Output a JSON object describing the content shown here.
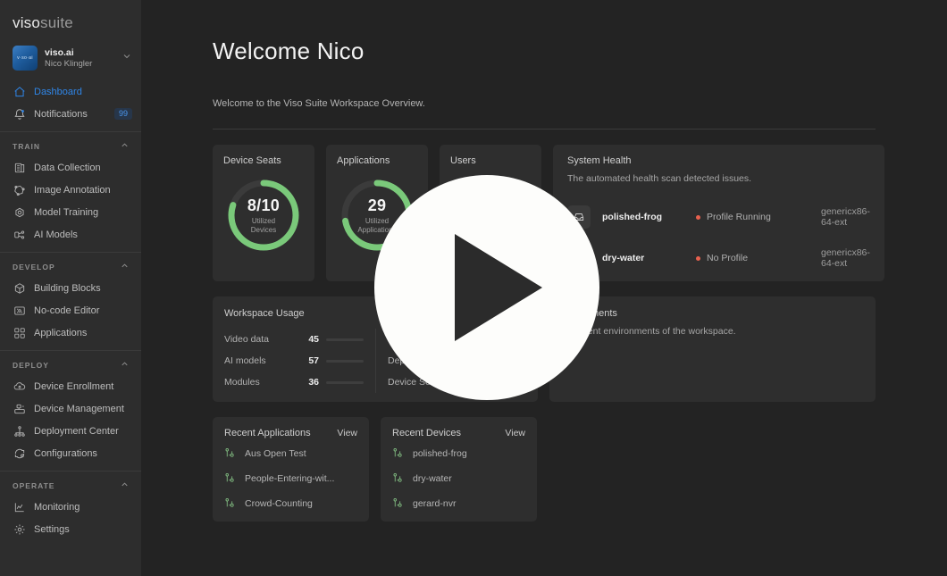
{
  "sidebar": {
    "logo": {
      "bold": "viso",
      "light": "suite"
    },
    "account": {
      "avatar_text": "v·so·ai",
      "name": "viso.ai",
      "user": "Nico Klingler",
      "chevron": "chevron-down-icon"
    },
    "top_items": [
      {
        "label": "Dashboard",
        "icon": "home-icon",
        "active": true
      },
      {
        "label": "Notifications",
        "icon": "bell-icon",
        "badge": "99",
        "active": false
      }
    ],
    "sections": [
      {
        "title": "TRAIN",
        "items": [
          {
            "label": "Data Collection",
            "icon": "database-icon"
          },
          {
            "label": "Image Annotation",
            "icon": "annotation-icon"
          },
          {
            "label": "Model Training",
            "icon": "training-icon"
          },
          {
            "label": "AI Models",
            "icon": "models-icon"
          }
        ]
      },
      {
        "title": "DEVELOP",
        "items": [
          {
            "label": "Building Blocks",
            "icon": "cube-icon"
          },
          {
            "label": "No-code Editor",
            "icon": "editor-icon"
          },
          {
            "label": "Applications",
            "icon": "applications-icon"
          }
        ]
      },
      {
        "title": "DEPLOY",
        "items": [
          {
            "label": "Device Enrollment",
            "icon": "cloud-upload-icon"
          },
          {
            "label": "Device Management",
            "icon": "device-manage-icon"
          },
          {
            "label": "Deployment Center",
            "icon": "hierarchy-icon"
          },
          {
            "label": "Configurations",
            "icon": "config-gear-icon"
          }
        ]
      },
      {
        "title": "OPERATE",
        "items": [
          {
            "label": "Monitoring",
            "icon": "chart-icon"
          },
          {
            "label": "Settings",
            "icon": "gear-icon"
          }
        ]
      }
    ]
  },
  "header": {
    "title": "Welcome Nico",
    "subtitle": "Welcome to the Viso Suite Workspace Overview."
  },
  "stats": [
    {
      "title": "Device Seats",
      "value": "8/10",
      "caption_line1": "Utilized",
      "caption_line2": "Devices",
      "percent": 80
    },
    {
      "title": "Applications",
      "value": "29",
      "caption_line1": "Utilized",
      "caption_line2": "Applications",
      "percent": 72
    },
    {
      "title": "Users",
      "value": "",
      "caption_line1": "",
      "caption_line2": "",
      "percent": 0
    }
  ],
  "system_health": {
    "title": "System Health",
    "subtitle": "The automated health scan detected issues.",
    "rows": [
      {
        "icon": "inbox-icon",
        "name": "polished-frog",
        "status": "Profile Running",
        "status_color": "#e8614e",
        "arch": "genericx86-64-ext"
      },
      {
        "icon": "inbox-icon",
        "name": "dry-water",
        "status": "No Profile",
        "status_color": "#e8614e",
        "arch": "genericx86-64-ext"
      }
    ]
  },
  "workspace_usage": {
    "title": "Workspace Usage",
    "left": [
      {
        "label": "Video data",
        "value": "45"
      },
      {
        "label": "AI models",
        "value": "57"
      },
      {
        "label": "Modules",
        "value": "36"
      }
    ],
    "right": [
      {
        "label": "",
        "value": ""
      },
      {
        "label": "Dep",
        "value": ""
      },
      {
        "label": "Device Sea",
        "value": ""
      }
    ]
  },
  "environments": {
    "title": "nvironments",
    "subtitle": "e current environments of the workspace."
  },
  "recent_applications": {
    "title": "Recent Applications",
    "view_label": "View",
    "items": [
      {
        "icon": "node-icon",
        "label": "Aus Open Test"
      },
      {
        "icon": "node-icon",
        "label": "People-Entering-wit..."
      },
      {
        "icon": "node-icon",
        "label": "Crowd-Counting"
      }
    ]
  },
  "recent_devices": {
    "title": "Recent Devices",
    "view_label": "View",
    "items": [
      {
        "icon": "node-icon",
        "label": "polished-frog"
      },
      {
        "icon": "node-icon",
        "label": "dry-water"
      },
      {
        "icon": "node-icon",
        "label": "gerard-nvr"
      }
    ]
  },
  "overlay": {
    "icon": "play-button-icon"
  },
  "colors": {
    "accent": "#2f86e8",
    "green": "#7ac97a",
    "red": "#e8614e",
    "card": "#2e2e2e",
    "page": "#232323",
    "sidebar": "#2d2d2d"
  }
}
